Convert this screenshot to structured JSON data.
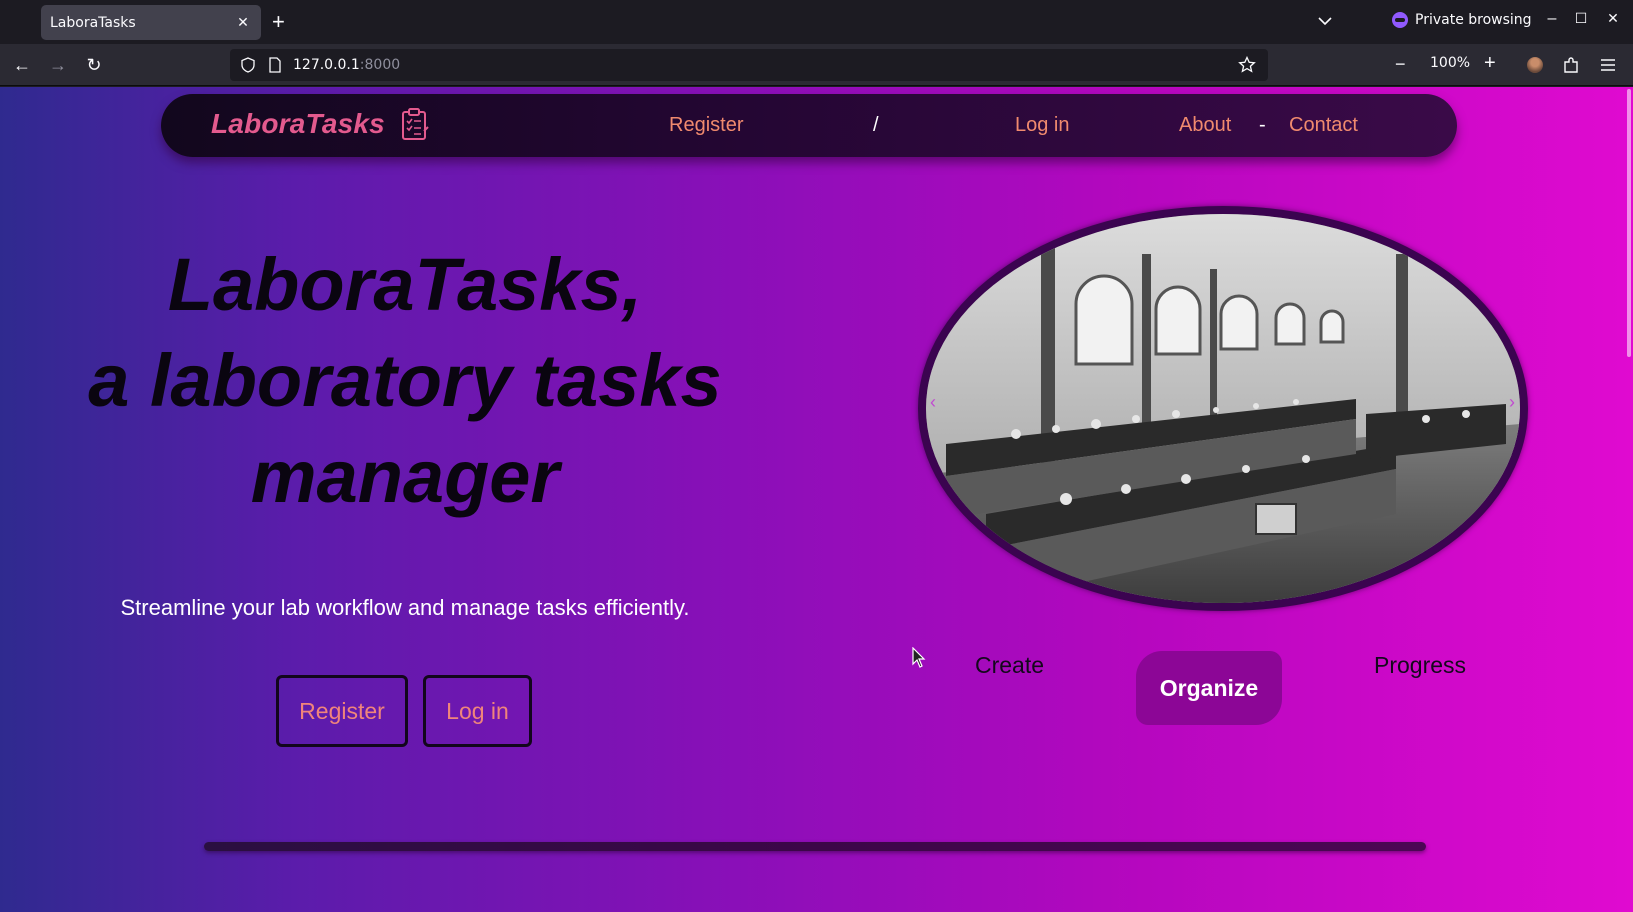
{
  "browser": {
    "tab_title": "LaboraTasks",
    "tab_close_icon": "close-icon",
    "new_tab_icon": "plus-icon",
    "private_label": "Private browsing",
    "url_host": "127.0.0.1",
    "url_port": ":8000",
    "zoom_level": "100%",
    "zoom_out_glyph": "−",
    "zoom_in_glyph": "+",
    "back_glyph": "←",
    "forward_glyph": "→",
    "reload_glyph": "↻",
    "minimize_glyph": "–",
    "maximize_glyph": "☐",
    "close_glyph": "✕"
  },
  "site_nav": {
    "brand": "LaboraTasks",
    "brand_icon": "clipboard-checklist-icon",
    "register": "Register",
    "sep_slash": "/",
    "login": "Log in",
    "about": "About",
    "sep_dash": "-",
    "contact": "Contact"
  },
  "hero": {
    "title_line1": "LaboraTasks,",
    "title_line2": "a laboratory tasks",
    "title_line3": "manager",
    "subtitle": "Streamline your lab workflow and manage tasks efficiently.",
    "register_button": "Register",
    "login_button": "Log in"
  },
  "carousel": {
    "prev_glyph": "‹",
    "next_glyph": "›"
  },
  "features": {
    "create": "Create",
    "organize": "Organize",
    "progress": "Progress",
    "active": "Organize"
  },
  "colors": {
    "brand_accent": "#e35a8e",
    "nav_link": "#f08a6e",
    "active_feature_bg": "#8c0696"
  }
}
